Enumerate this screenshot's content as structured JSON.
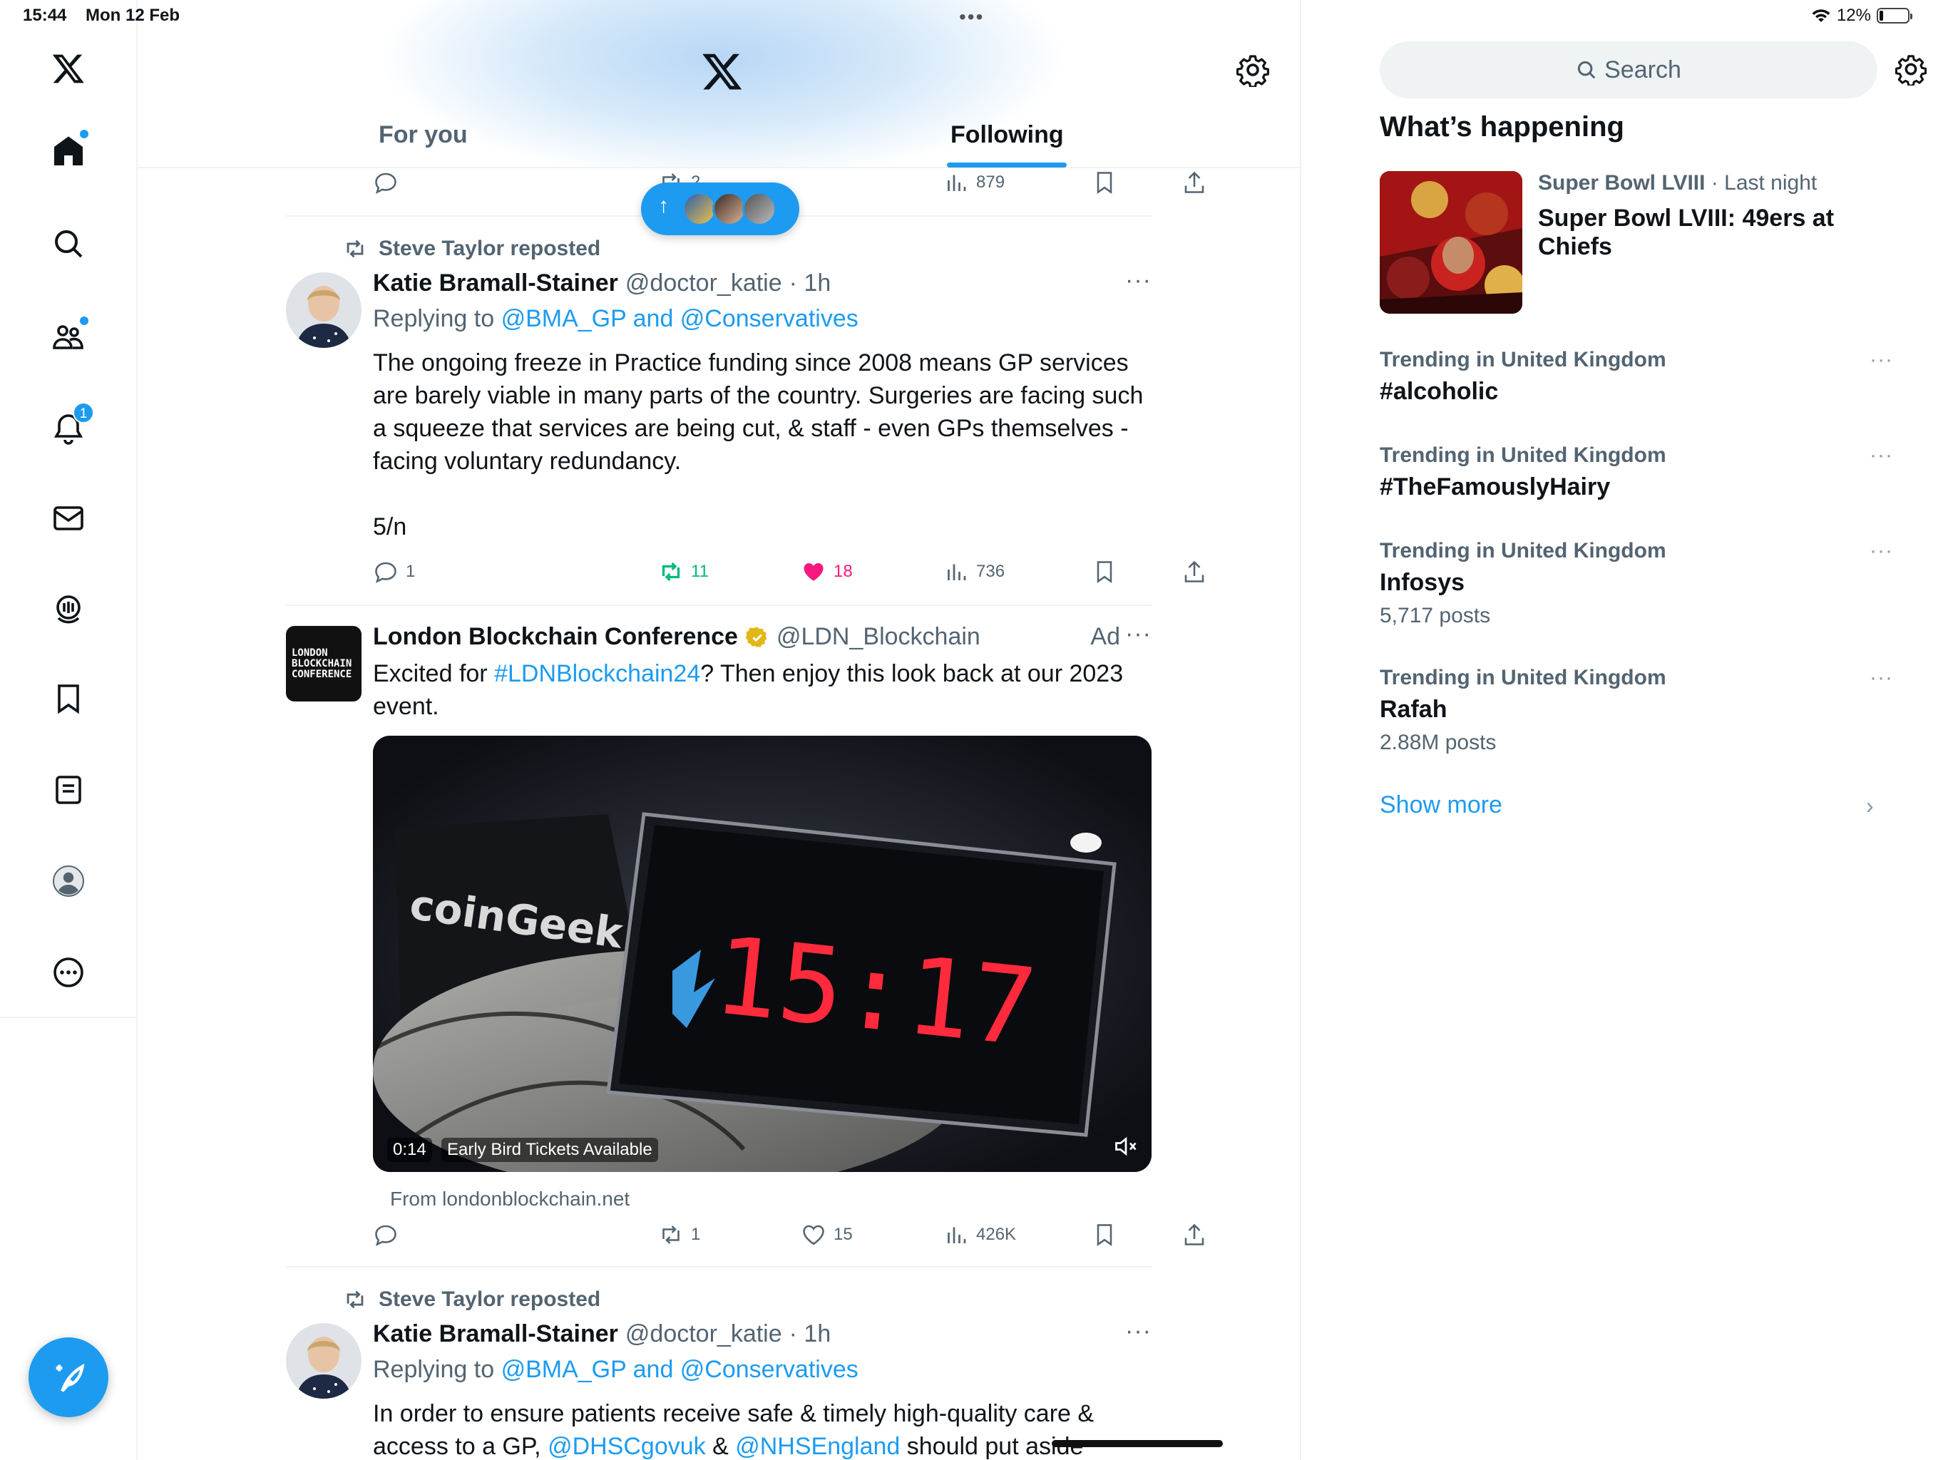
{
  "status": {
    "time": "15:44",
    "date": "Mon 12 Feb",
    "battery": "12%",
    "battery_level": 0.12
  },
  "nav": {
    "items": [
      "home-icon",
      "search-icon",
      "communities-icon",
      "notifications-icon",
      "messages-icon",
      "spaces-icon",
      "bookmarks-icon",
      "lists-icon",
      "profile-icon",
      "more-icon"
    ],
    "notifications_count": "1"
  },
  "header": {
    "tabs": [
      {
        "label": "For you",
        "selected": false
      },
      {
        "label": "Following",
        "selected": true
      }
    ]
  },
  "posts": [
    {
      "partial_actions": {
        "replies": "",
        "reposts": "2",
        "likes": "",
        "views": "879"
      }
    },
    {
      "repost_by": "Steve Taylor reposted",
      "name": "Katie Bramall-Stainer",
      "handle": "@doctor_katie",
      "time": "· 1h",
      "reply_prefix": "Replying to",
      "reply_to": "@BMA_GP and @Conservatives",
      "text": "The ongoing freeze in Practice funding since 2008 means GP services are barely viable in many parts of the country. Surgeries are facing such a squeeze that services are being cut, & staff - even GPs themselves - facing voluntary redundancy.",
      "text2": "5/n",
      "replies": "1",
      "reposts": "11",
      "likes": "18",
      "views": "736",
      "reposted_by_me": true,
      "liked": true
    },
    {
      "name": "London Blockchain Conference",
      "verified": true,
      "handle": "@LDN_Blockchain",
      "ad_label": "Ad",
      "avatar_text": "LONDON BLOCKCHAIN CONFERENCE",
      "text_before": "Excited for ",
      "hashtag": "#LDNBlockchain24",
      "text_after": "? Then enjoy this look back at our 2023 event.",
      "video": {
        "time": "0:14",
        "cta": "Early Bird Tickets Available",
        "clock_text": "15:17",
        "cup_text": "coinGeek",
        "muted": true
      },
      "source": "From londonblockchain.net",
      "replies": "",
      "reposts": "1",
      "likes": "15",
      "views": "426K"
    },
    {
      "repost_by": "Steve Taylor reposted",
      "name": "Katie Bramall-Stainer",
      "handle": "@doctor_katie",
      "time": "· 1h",
      "reply_prefix": "Replying to",
      "reply_to": "@BMA_GP and @Conservatives",
      "text_before": "In order to ensure patients receive safe & timely high-quality care & access to a GP, ",
      "mention1": "@DHSCgovuk",
      "amp": " & ",
      "mention2": "@NHSEngland",
      "text_after": " should put aside"
    }
  ],
  "sidebar": {
    "search_placeholder": "Search",
    "heading": "What’s happening",
    "event": {
      "category": "Super Bowl LVIII",
      "when": " · Last night",
      "title": "Super Bowl LVIII: 49ers at Chiefs"
    },
    "trends": [
      {
        "context": "Trending in United Kingdom",
        "name": "#alcoholic",
        "count": ""
      },
      {
        "context": "Trending in United Kingdom",
        "name": "#TheFamouslyHairy",
        "count": ""
      },
      {
        "context": "Trending in United Kingdom",
        "name": "Infosys",
        "count": "5,717 posts"
      },
      {
        "context": "Trending in United Kingdom",
        "name": "Rafah",
        "count": "2.88M posts"
      }
    ],
    "show_more": "Show more"
  },
  "colors": {
    "accent": "#1d9bf0",
    "like": "#f91880",
    "repost": "#00ba7c",
    "secondary_text": "#536471"
  }
}
